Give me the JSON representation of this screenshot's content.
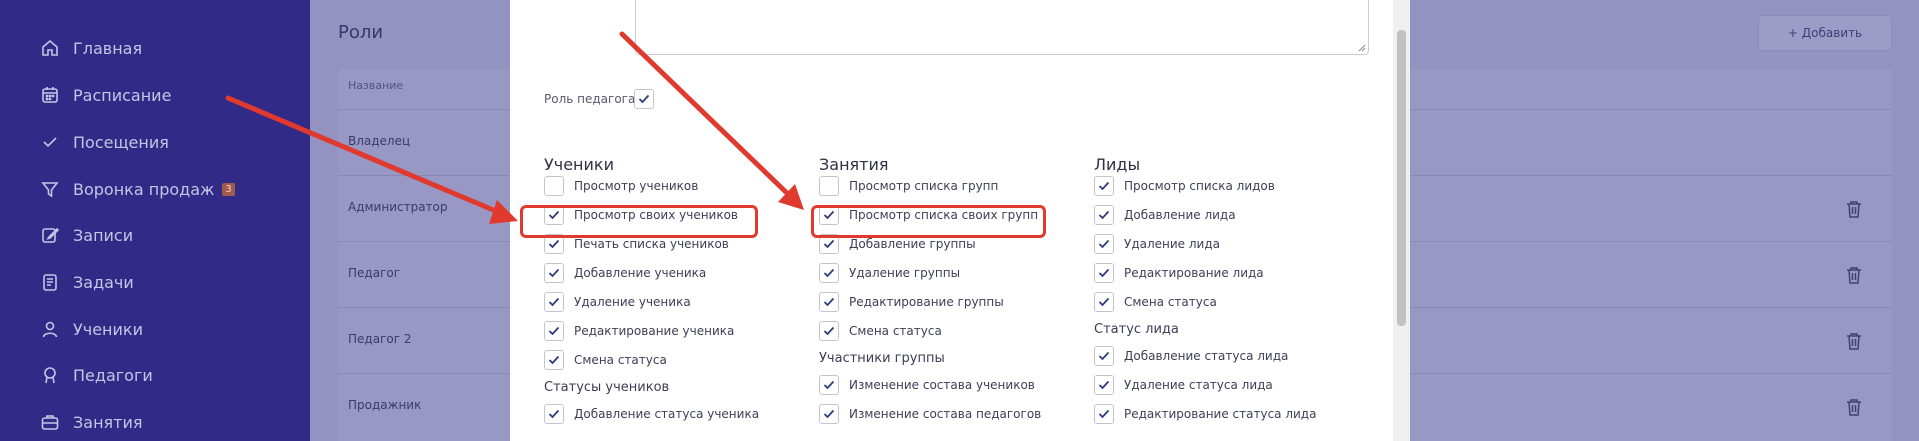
{
  "sidebar": {
    "items": [
      {
        "label": "Главная",
        "icon": "home-icon"
      },
      {
        "label": "Расписание",
        "icon": "calendar-icon"
      },
      {
        "label": "Посещения",
        "icon": "check-icon"
      },
      {
        "label": "Воронка продаж",
        "icon": "funnel-icon",
        "badge": "3"
      },
      {
        "label": "Записи",
        "icon": "edit-icon"
      },
      {
        "label": "Задачи",
        "icon": "tasks-icon"
      },
      {
        "label": "Ученики",
        "icon": "user-icon"
      },
      {
        "label": "Педагоги",
        "icon": "teacher-icon"
      },
      {
        "label": "Занятия",
        "icon": "briefcase-icon"
      }
    ]
  },
  "page": {
    "title": "Роли",
    "add_button": "+ Добавить",
    "column_name": "Название",
    "rows": [
      "Владелец",
      "Администратор",
      "Педагог",
      "Педагог 2",
      "Продажник"
    ]
  },
  "modal": {
    "teacher_role_label": "Роль педагога",
    "teacher_role_checked": true,
    "columns": [
      {
        "title": "Ученики",
        "items": [
          {
            "label": "Просмотр учеников",
            "checked": false
          },
          {
            "label": "Просмотр своих учеников",
            "checked": true
          },
          {
            "label": "Печать списка учеников",
            "checked": true
          },
          {
            "label": "Добавление ученика",
            "checked": true
          },
          {
            "label": "Удаление ученика",
            "checked": true
          },
          {
            "label": "Редактирование ученика",
            "checked": true
          },
          {
            "label": "Смена статуса",
            "checked": true
          }
        ],
        "subtitle": "Статусы учеников",
        "sub_items": [
          {
            "label": "Добавление статуса ученика",
            "checked": true
          }
        ]
      },
      {
        "title": "Занятия",
        "items": [
          {
            "label": "Просмотр списка групп",
            "checked": false
          },
          {
            "label": "Просмотр списка своих групп",
            "checked": true
          },
          {
            "label": "Добавление группы",
            "checked": true
          },
          {
            "label": "Удаление группы",
            "checked": true
          },
          {
            "label": "Редактирование группы",
            "checked": true
          },
          {
            "label": "Смена статуса",
            "checked": true
          }
        ],
        "subtitle": "Участники группы",
        "sub_items": [
          {
            "label": "Изменение состава учеников",
            "checked": true
          },
          {
            "label": "Изменение состава педагогов",
            "checked": true
          }
        ]
      },
      {
        "title": "Лиды",
        "items": [
          {
            "label": "Просмотр списка лидов",
            "checked": true
          },
          {
            "label": "Добавление лида",
            "checked": true
          },
          {
            "label": "Удаление лида",
            "checked": true
          },
          {
            "label": "Редактирование лида",
            "checked": true
          },
          {
            "label": "Смена статуса",
            "checked": true
          }
        ],
        "subtitle": "Статус лида",
        "sub_items": [
          {
            "label": "Добавление статуса лида",
            "checked": true
          },
          {
            "label": "Удаление статуса лида",
            "checked": true
          },
          {
            "label": "Редактирование статуса лида",
            "checked": true
          }
        ]
      }
    ]
  },
  "colors": {
    "sidebar_bg": "#312a86",
    "overlay_bg": "#9392c0",
    "accent": "#2f3a7c",
    "highlight": "#e03a2f"
  }
}
